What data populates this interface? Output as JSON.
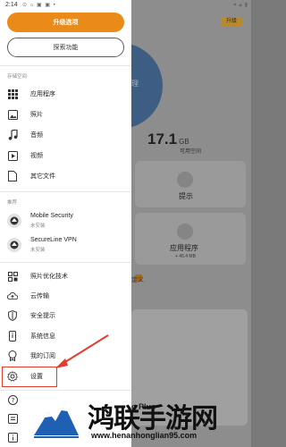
{
  "status_bar": {
    "time": "2:14",
    "icons": "⊙ ⌂ ▣ ▣ •",
    "right_icons": "▾ ▲ ▮"
  },
  "background_app": {
    "upgrade_pill": "升级",
    "donut_text": "理",
    "storage_value": "17.1",
    "storage_unit": "GB",
    "storage_caption": "可用空间",
    "card_tips": "提示",
    "card_apps": "应用程序",
    "card_apps_size": "+ 46.4 MB",
    "faded_text": "定义",
    "promo_text": "o Plus"
  },
  "drawer": {
    "upgrade_button": "升级选项",
    "explore_button": "探索功能",
    "storage_section": "存储空间",
    "storage_items": [
      {
        "label": "应用程序",
        "icon": "grid-icon"
      },
      {
        "label": "照片",
        "icon": "image-icon"
      },
      {
        "label": "音频",
        "icon": "music-icon"
      },
      {
        "label": "视频",
        "icon": "video-icon"
      },
      {
        "label": "其它文件",
        "icon": "file-icon"
      }
    ],
    "recommend_section": "推荐",
    "recommendations": [
      {
        "title": "Mobile Security",
        "subtitle": "未安装"
      },
      {
        "title": "SecureLine VPN",
        "subtitle": "未安装"
      }
    ],
    "tool_items": [
      {
        "label": "照片优化技术",
        "icon": "photo-optimizer-icon"
      },
      {
        "label": "云传输",
        "icon": "cloud-upload-icon"
      },
      {
        "label": "安全提示",
        "icon": "shield-icon"
      },
      {
        "label": "系统信息",
        "icon": "phone-info-icon"
      },
      {
        "label": "我的订阅",
        "icon": "subscription-icon"
      },
      {
        "label": "设置",
        "icon": "gear-icon"
      }
    ],
    "bottom_items": [
      {
        "icon": "help-icon"
      },
      {
        "icon": "feedback-icon"
      },
      {
        "icon": "info-icon"
      }
    ]
  },
  "watermark": {
    "title": "鸿联手游网",
    "url": "www.henanhonglian95.com"
  },
  "colors": {
    "accent_orange": "#ea8b19",
    "highlight_red": "#e33b2f"
  }
}
